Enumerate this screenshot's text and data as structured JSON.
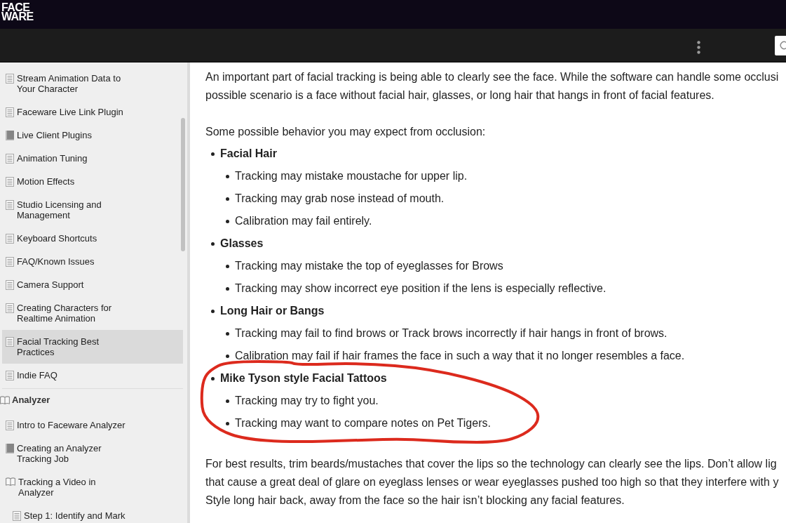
{
  "header": {
    "logo": [
      "FACE",
      "WARE"
    ]
  },
  "sidebar": {
    "sections": [
      {
        "items": [
          {
            "kind": "page",
            "label": "Stream Animation Data to Your Character",
            "selected": false
          },
          {
            "kind": "page",
            "label": "Faceware Live Link Plugin",
            "selected": false
          },
          {
            "kind": "book",
            "label": "Live Client Plugins",
            "expanded": false,
            "selected": false
          },
          {
            "kind": "page",
            "label": "Animation Tuning",
            "selected": false
          },
          {
            "kind": "page",
            "label": "Motion Effects",
            "selected": false
          },
          {
            "kind": "page",
            "label": "Studio Licensing and Management",
            "selected": false
          },
          {
            "kind": "page",
            "label": "Keyboard Shortcuts",
            "selected": false
          },
          {
            "kind": "page",
            "label": "FAQ/Known Issues",
            "selected": false
          },
          {
            "kind": "page",
            "label": "Camera Support",
            "selected": false
          },
          {
            "kind": "page",
            "label": "Creating Characters for Realtime Animation",
            "selected": false
          },
          {
            "kind": "page",
            "label": "Facial Tracking Best Practices",
            "selected": true
          },
          {
            "kind": "page",
            "label": "Indie FAQ",
            "selected": false
          }
        ]
      },
      {
        "title": "Analyzer",
        "expanded": true,
        "selected": false,
        "items": [
          {
            "kind": "page",
            "label": "Intro to Faceware Analyzer",
            "selected": false
          },
          {
            "kind": "book",
            "label": "Creating an Analyzer Tracking Job",
            "expanded": false,
            "selected": false
          },
          {
            "kind": "book",
            "label": "Tracking a Video in Analyzer",
            "expanded": true,
            "selected": false,
            "children": [
              {
                "kind": "page",
                "label": "Step 1: Identify and Mark",
                "selected": false
              }
            ]
          }
        ]
      }
    ]
  },
  "article": {
    "blocks": [
      {
        "kind": "paragraph",
        "lines": [
          "An important part of facial tracking is being able to clearly see the face. While the software can handle some occlusi",
          "possible scenario is a face without facial hair, glasses, or long hair that hangs in front of facial features."
        ]
      },
      {
        "kind": "paragraph",
        "lines": [
          "Some possible behavior you may expect from occlusion:"
        ]
      },
      {
        "kind": "list",
        "items": [
          {
            "heading": "Facial Hair",
            "circled": false,
            "points": [
              "Tracking may mistake moustache for upper lip.",
              "Tracking may grab nose instead of mouth.",
              "Calibration may fail entirely."
            ]
          },
          {
            "heading": "Glasses",
            "circled": false,
            "points": [
              "Tracking may mistake the top of eyeglasses for Brows",
              "Tracking may show incorrect eye position if the lens is especially reflective."
            ]
          },
          {
            "heading": "Long Hair or Bangs",
            "circled": false,
            "points": [
              "Tracking may fail to find brows or Track brows incorrectly if hair hangs in front of brows.",
              "Calibration may fail if hair frames the face in such a way that it no longer resembles a face."
            ]
          },
          {
            "heading": "Mike Tyson style Facial Tattoos",
            "circled": true,
            "points": [
              "Tracking may try to fight you.",
              "Tracking may want to compare notes on Pet Tigers."
            ]
          }
        ]
      },
      {
        "kind": "paragraph",
        "lines": [
          "For best results, trim beards/mustaches that cover the lips so the technology can clearly see the lips. Don’t allow lig",
          "that cause a great deal of glare on eyeglass lenses or wear eyeglasses pushed too high so that they interfere with y",
          "Style long hair back, away from the face so the hair isn’t blocking any facial features."
        ]
      }
    ]
  }
}
